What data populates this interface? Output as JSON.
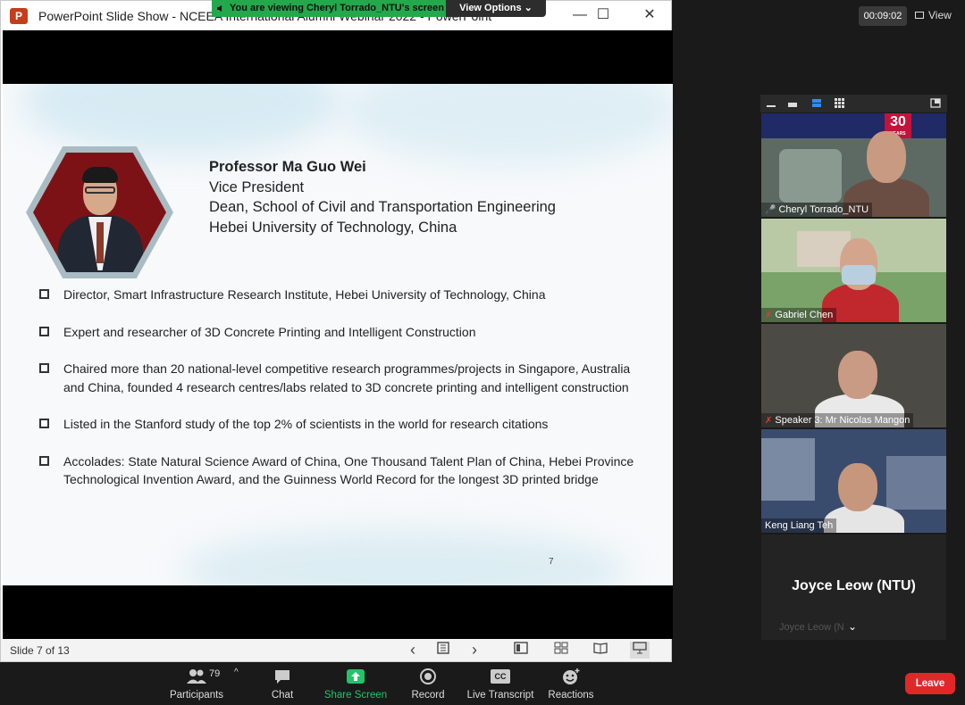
{
  "ppt_window": {
    "title": "PowerPoint Slide Show  -  NCEEA International Alumni Webinar 2022  -  PowerPoint",
    "logo_letter": "P",
    "minimize": "—",
    "maximize": "☐",
    "close": "✕"
  },
  "share_banner": {
    "text": "You are viewing Cheryl Torrado_NTU's screen",
    "view_options": "View Options ⌄"
  },
  "slide": {
    "speaker_name": "Professor Ma Guo Wei",
    "speaker_role": "Vice President",
    "speaker_dept": "Dean, School of Civil and Transportation Engineering",
    "speaker_org": "Hebei University of Technology, China",
    "bullets": [
      "Director, Smart Infrastructure Research Institute, Hebei University of Technology, China",
      "Expert and researcher of 3D Concrete Printing and Intelligent Construction",
      "Chaired more than 20 national-level competitive research programmes/projects in Singapore, Australia and China, founded 4 research centres/labs related to 3D concrete printing and intelligent construction",
      "Listed in the Stanford study of the top 2% of scientists in the world for research citations",
      "Accolades: State Natural Science Award of China, One Thousand Talent Plan of China, Hebei Province Technological Invention Award,  and the Guinness World Record for the longest 3D printed bridge"
    ],
    "page_number": "7"
  },
  "ppt_status": {
    "slide_count": "Slide 7 of 13",
    "prev": "‹",
    "next": "›"
  },
  "zoom": {
    "timer": "00:09:02",
    "view_label": "View",
    "participants": [
      {
        "name": "Cheryl Torrado_NTU",
        "muted": false
      },
      {
        "name": "Gabriel Chen",
        "muted": true
      },
      {
        "name": "Speaker 3: Mr Nicolas Mangon",
        "muted": true
      },
      {
        "name": "Keng Liang Teh",
        "muted": false
      },
      {
        "name": "Joyce Leow (NTU)",
        "muted": false
      }
    ],
    "ghost_label": "Joyce Leow (N",
    "chevron": "⌄",
    "tile1_banner": "30",
    "tile1_banner_sub": "YEARS",
    "toolbar": {
      "participants_label": "Participants",
      "participants_count": "79",
      "caret": "^",
      "chat_label": "Chat",
      "share_label": "Share Screen",
      "record_label": "Record",
      "transcript_label": "Live Transcript",
      "transcript_icon": "CC",
      "reactions_label": "Reactions",
      "leave_label": "Leave"
    }
  },
  "colors": {
    "zoom_green": "#23a84b",
    "leave_red": "#e02828",
    "ppt_logo": "#c43e1c"
  }
}
